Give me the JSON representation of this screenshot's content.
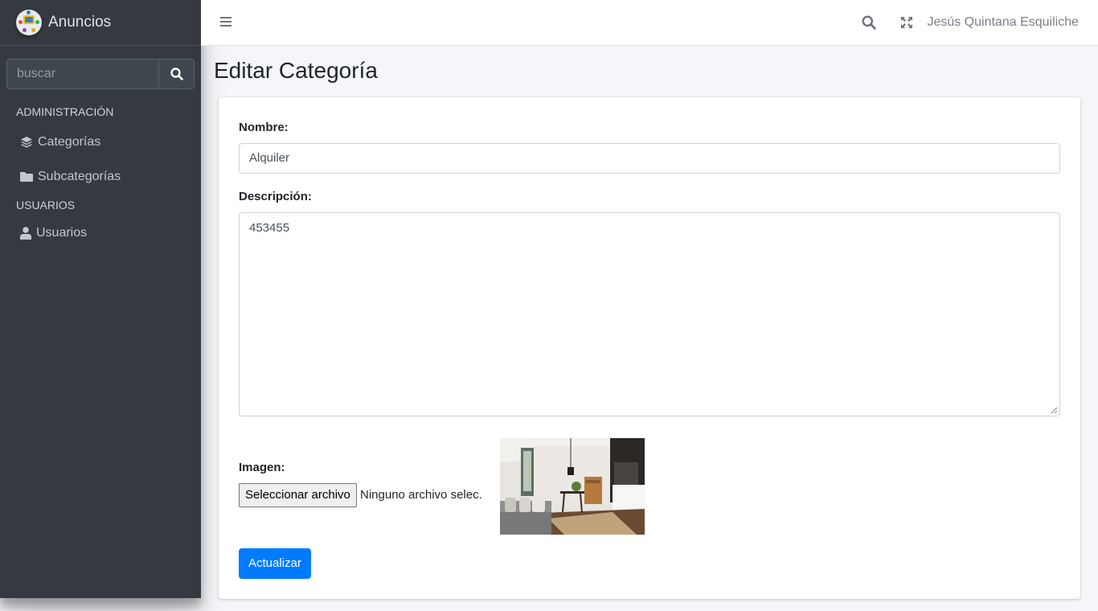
{
  "sidebar": {
    "brand": "Anuncios",
    "search": {
      "placeholder": "buscar",
      "value": ""
    },
    "sections": [
      {
        "header": "ADMINISTRACIÓN",
        "items": [
          {
            "label": "Categorías",
            "icon": "layers-icon"
          },
          {
            "label": "Subcategorías",
            "icon": "folder-icon"
          }
        ]
      },
      {
        "header": "USUARIOS",
        "items": [
          {
            "label": "Usuarios",
            "icon": "user-icon"
          }
        ]
      }
    ]
  },
  "topbar": {
    "menu_icon": "hamburger-icon",
    "search_icon": "search-icon",
    "fullscreen_icon": "expand-icon",
    "user_name": "Jesús Quintana Esquiliche"
  },
  "page": {
    "title": "Editar Categoría",
    "form": {
      "name_label": "Nombre:",
      "name_value": "Alquiler",
      "description_label": "Descripción:",
      "description_value": "453455",
      "image_label": "Imagen:",
      "file_button_label": "Seleccionar archivo",
      "file_status": "Ninguno archivo selec.",
      "submit_label": "Actualizar"
    }
  },
  "colors": {
    "sidebar_bg": "#343a40",
    "primary": "#007bff",
    "content_bg": "#f4f6f9"
  }
}
